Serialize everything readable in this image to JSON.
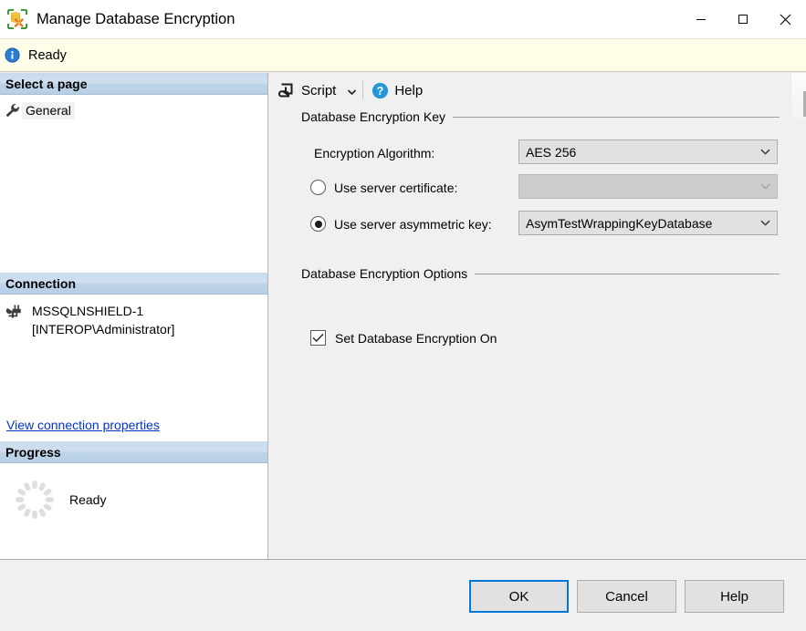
{
  "window": {
    "title": "Manage Database Encryption",
    "icon": "database-encryption-icon",
    "minimize_label": "Minimize",
    "maximize_label": "Maximize",
    "close_label": "Close"
  },
  "status": {
    "icon": "info-icon",
    "text": "Ready"
  },
  "sidebar": {
    "select_page": {
      "header": "Select a page",
      "items": [
        {
          "label": "General",
          "icon": "wrench-icon",
          "selected": true
        }
      ]
    },
    "connection": {
      "header": "Connection",
      "icon": "server-connection-icon",
      "server": "MSSQLNSHIELD-1",
      "user": "[INTEROP\\Administrator]",
      "link": "View connection properties"
    },
    "progress": {
      "header": "Progress",
      "icon": "spinner-icon",
      "text": "Ready"
    }
  },
  "toolbar": {
    "script_label": "Script",
    "script_icon": "script-icon",
    "script_caret_icon": "chevron-down-icon",
    "help_label": "Help",
    "help_icon": "help-circle-icon"
  },
  "main": {
    "groups": {
      "encryption_key": {
        "caption": "Database Encryption Key",
        "algorithm_label": "Encryption Algorithm:",
        "algorithm_value": "AES 256",
        "certificate_label": "Use server certificate:",
        "certificate_value": "",
        "certificate_selected": false,
        "certificate_enabled": false,
        "asymmetric_label": "Use server asymmetric key:",
        "asymmetric_value": "AsymTestWrappingKeyDatabase",
        "asymmetric_selected": true
      },
      "encryption_options": {
        "caption": "Database Encryption Options",
        "set_encryption_label": "Set Database Encryption On",
        "set_encryption_checked": true
      }
    }
  },
  "footer": {
    "ok": "OK",
    "cancel": "Cancel",
    "help": "Help"
  },
  "colors": {
    "accent": "#0078d7",
    "link": "#0033cc",
    "status_bg": "#fdfde8",
    "panel_bg": "#f0f0f0",
    "section_header": "#c4d8ea"
  }
}
